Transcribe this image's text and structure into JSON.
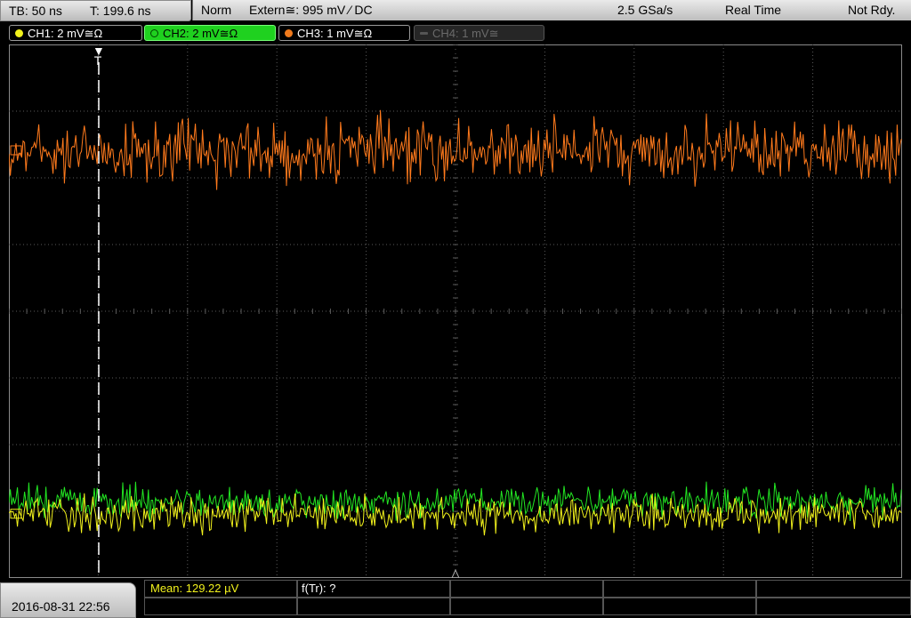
{
  "status": {
    "timebase": "TB: 50 ns",
    "trigger_time": "T: 199.6 ns",
    "mode": "Norm",
    "trigger_source": "Extern≅: 995 mV ⁄ DC",
    "sample_rate": "2.5 GSa/s",
    "acq_mode": "Real Time",
    "state": "Not Rdy."
  },
  "channels": [
    {
      "label": "CH1: 2 mV≅Ω",
      "color": "#f2f21c",
      "active": true
    },
    {
      "label": "CH2: 2 mV≅Ω",
      "color": "#1fd11f",
      "active": true,
      "selected": true
    },
    {
      "label": "CH3: 1 mV≅Ω",
      "color": "#f07a1c",
      "active": true
    },
    {
      "label": "CH4: 1 mV≅",
      "color": "#666666",
      "active": false
    }
  ],
  "trigger_marker_label": "T",
  "footer": {
    "datetime": "2016-08-31 22:56",
    "measurement_1": "Mean: 129.22 µV",
    "measurement_2": "f(Tr): ?"
  },
  "colors": {
    "ch1": "#f2f21c",
    "ch2": "#22e622",
    "ch3": "#ff7a1c",
    "grid": "#5a5a5a",
    "measurement_text": "#f2f21c"
  },
  "chart_data": {
    "type": "line",
    "title": "",
    "xlabel": "",
    "ylabel": "",
    "grid": true,
    "x_divisions": 10,
    "y_divisions": 8,
    "series": [
      {
        "name": "CH3",
        "baseline_div": 1.6,
        "noise_pp_div": 1.3
      },
      {
        "name": "CH2",
        "baseline_div": 6.85,
        "noise_pp_div": 0.7
      },
      {
        "name": "CH1",
        "baseline_div": 7.05,
        "noise_pp_div": 0.75
      }
    ]
  }
}
